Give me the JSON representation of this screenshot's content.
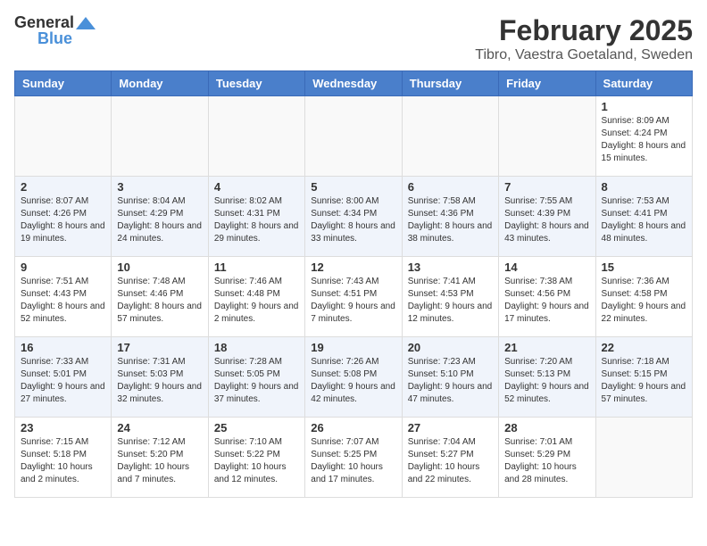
{
  "logo": {
    "general": "General",
    "blue": "Blue"
  },
  "title": "February 2025",
  "location": "Tibro, Vaestra Goetaland, Sweden",
  "weekdays": [
    "Sunday",
    "Monday",
    "Tuesday",
    "Wednesday",
    "Thursday",
    "Friday",
    "Saturday"
  ],
  "weeks": [
    [
      {
        "day": "",
        "info": ""
      },
      {
        "day": "",
        "info": ""
      },
      {
        "day": "",
        "info": ""
      },
      {
        "day": "",
        "info": ""
      },
      {
        "day": "",
        "info": ""
      },
      {
        "day": "",
        "info": ""
      },
      {
        "day": "1",
        "info": "Sunrise: 8:09 AM\nSunset: 4:24 PM\nDaylight: 8 hours and 15 minutes."
      }
    ],
    [
      {
        "day": "2",
        "info": "Sunrise: 8:07 AM\nSunset: 4:26 PM\nDaylight: 8 hours and 19 minutes."
      },
      {
        "day": "3",
        "info": "Sunrise: 8:04 AM\nSunset: 4:29 PM\nDaylight: 8 hours and 24 minutes."
      },
      {
        "day": "4",
        "info": "Sunrise: 8:02 AM\nSunset: 4:31 PM\nDaylight: 8 hours and 29 minutes."
      },
      {
        "day": "5",
        "info": "Sunrise: 8:00 AM\nSunset: 4:34 PM\nDaylight: 8 hours and 33 minutes."
      },
      {
        "day": "6",
        "info": "Sunrise: 7:58 AM\nSunset: 4:36 PM\nDaylight: 8 hours and 38 minutes."
      },
      {
        "day": "7",
        "info": "Sunrise: 7:55 AM\nSunset: 4:39 PM\nDaylight: 8 hours and 43 minutes."
      },
      {
        "day": "8",
        "info": "Sunrise: 7:53 AM\nSunset: 4:41 PM\nDaylight: 8 hours and 48 minutes."
      }
    ],
    [
      {
        "day": "9",
        "info": "Sunrise: 7:51 AM\nSunset: 4:43 PM\nDaylight: 8 hours and 52 minutes."
      },
      {
        "day": "10",
        "info": "Sunrise: 7:48 AM\nSunset: 4:46 PM\nDaylight: 8 hours and 57 minutes."
      },
      {
        "day": "11",
        "info": "Sunrise: 7:46 AM\nSunset: 4:48 PM\nDaylight: 9 hours and 2 minutes."
      },
      {
        "day": "12",
        "info": "Sunrise: 7:43 AM\nSunset: 4:51 PM\nDaylight: 9 hours and 7 minutes."
      },
      {
        "day": "13",
        "info": "Sunrise: 7:41 AM\nSunset: 4:53 PM\nDaylight: 9 hours and 12 minutes."
      },
      {
        "day": "14",
        "info": "Sunrise: 7:38 AM\nSunset: 4:56 PM\nDaylight: 9 hours and 17 minutes."
      },
      {
        "day": "15",
        "info": "Sunrise: 7:36 AM\nSunset: 4:58 PM\nDaylight: 9 hours and 22 minutes."
      }
    ],
    [
      {
        "day": "16",
        "info": "Sunrise: 7:33 AM\nSunset: 5:01 PM\nDaylight: 9 hours and 27 minutes."
      },
      {
        "day": "17",
        "info": "Sunrise: 7:31 AM\nSunset: 5:03 PM\nDaylight: 9 hours and 32 minutes."
      },
      {
        "day": "18",
        "info": "Sunrise: 7:28 AM\nSunset: 5:05 PM\nDaylight: 9 hours and 37 minutes."
      },
      {
        "day": "19",
        "info": "Sunrise: 7:26 AM\nSunset: 5:08 PM\nDaylight: 9 hours and 42 minutes."
      },
      {
        "day": "20",
        "info": "Sunrise: 7:23 AM\nSunset: 5:10 PM\nDaylight: 9 hours and 47 minutes."
      },
      {
        "day": "21",
        "info": "Sunrise: 7:20 AM\nSunset: 5:13 PM\nDaylight: 9 hours and 52 minutes."
      },
      {
        "day": "22",
        "info": "Sunrise: 7:18 AM\nSunset: 5:15 PM\nDaylight: 9 hours and 57 minutes."
      }
    ],
    [
      {
        "day": "23",
        "info": "Sunrise: 7:15 AM\nSunset: 5:18 PM\nDaylight: 10 hours and 2 minutes."
      },
      {
        "day": "24",
        "info": "Sunrise: 7:12 AM\nSunset: 5:20 PM\nDaylight: 10 hours and 7 minutes."
      },
      {
        "day": "25",
        "info": "Sunrise: 7:10 AM\nSunset: 5:22 PM\nDaylight: 10 hours and 12 minutes."
      },
      {
        "day": "26",
        "info": "Sunrise: 7:07 AM\nSunset: 5:25 PM\nDaylight: 10 hours and 17 minutes."
      },
      {
        "day": "27",
        "info": "Sunrise: 7:04 AM\nSunset: 5:27 PM\nDaylight: 10 hours and 22 minutes."
      },
      {
        "day": "28",
        "info": "Sunrise: 7:01 AM\nSunset: 5:29 PM\nDaylight: 10 hours and 28 minutes."
      },
      {
        "day": "",
        "info": ""
      }
    ]
  ]
}
